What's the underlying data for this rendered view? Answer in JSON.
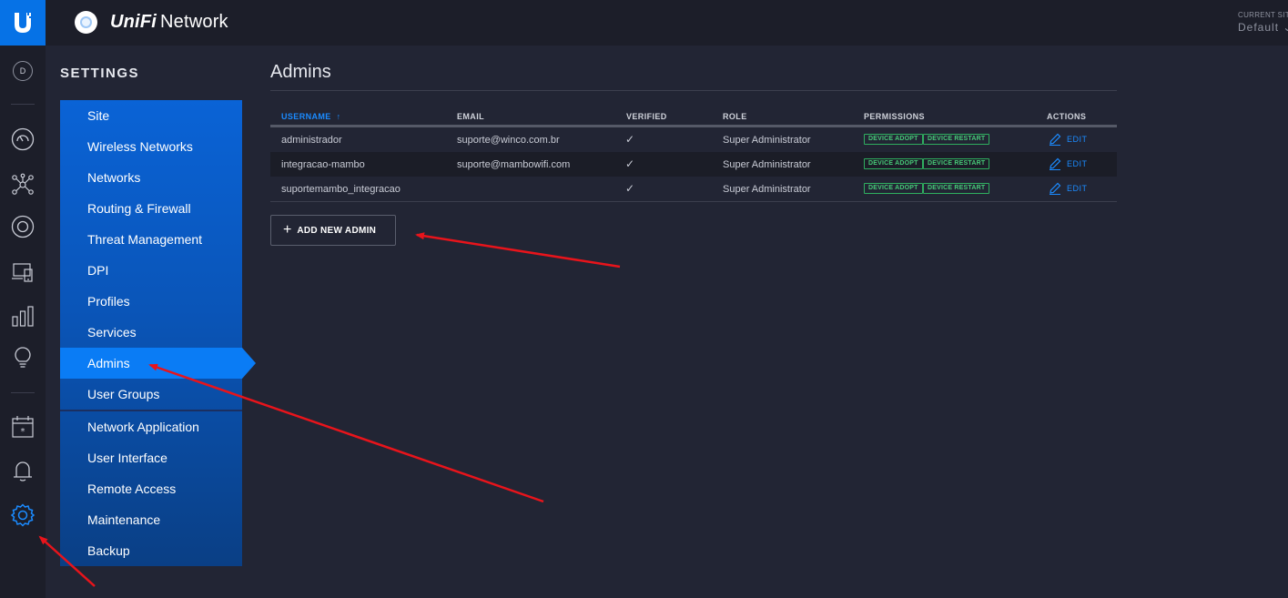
{
  "header": {
    "brand": "UniFi",
    "product": "Network",
    "site_label": "CURRENT SITE",
    "site_value": "Default"
  },
  "rail": {
    "avatar_letter": "D",
    "icons": [
      "dashboard-icon",
      "topology-icon",
      "devices-icon",
      "clients-icon",
      "statistics-icon",
      "insights-icon",
      "events-icon",
      "alerts-icon",
      "settings-icon"
    ]
  },
  "settings": {
    "title": "SETTINGS",
    "items": [
      {
        "label": "Site"
      },
      {
        "label": "Wireless Networks"
      },
      {
        "label": "Networks"
      },
      {
        "label": "Routing & Firewall"
      },
      {
        "label": "Threat Management"
      },
      {
        "label": "DPI"
      },
      {
        "label": "Profiles"
      },
      {
        "label": "Services"
      },
      {
        "label": "Admins",
        "active": true
      },
      {
        "label": "User Groups"
      },
      {
        "label": "Network Application"
      },
      {
        "label": "User Interface"
      },
      {
        "label": "Remote Access"
      },
      {
        "label": "Maintenance"
      },
      {
        "label": "Backup"
      }
    ]
  },
  "main": {
    "title": "Admins",
    "columns": {
      "username": "USERNAME",
      "email": "EMAIL",
      "verified": "VERIFIED",
      "role": "ROLE",
      "permissions": "PERMISSIONS",
      "actions": "ACTIONS"
    },
    "sort_indicator": "↑",
    "rows": [
      {
        "username": "administrador",
        "email": "suporte@winco.com.br",
        "verified": "✓",
        "role": "Super Administrator",
        "perm1": "DEVICE ADOPT",
        "perm2": "DEVICE RESTART",
        "action": "EDIT"
      },
      {
        "username": "integracao-mambo",
        "email": "suporte@mambowifi.com",
        "verified": "✓",
        "role": "Super Administrator",
        "perm1": "DEVICE ADOPT",
        "perm2": "DEVICE RESTART",
        "action": "EDIT"
      },
      {
        "username": "suportemambo_integracao",
        "email": "",
        "verified": "✓",
        "role": "Super Administrator",
        "perm1": "DEVICE ADOPT",
        "perm2": "DEVICE RESTART",
        "action": "EDIT"
      }
    ],
    "add_button": "ADD NEW ADMIN"
  },
  "colors": {
    "accent": "#0a7cf5",
    "menu_gradient_top": "#0a63d6",
    "menu_gradient_bottom": "#0a3a7a",
    "badge_green": "#47c978",
    "annotation_red": "#e8141b"
  }
}
